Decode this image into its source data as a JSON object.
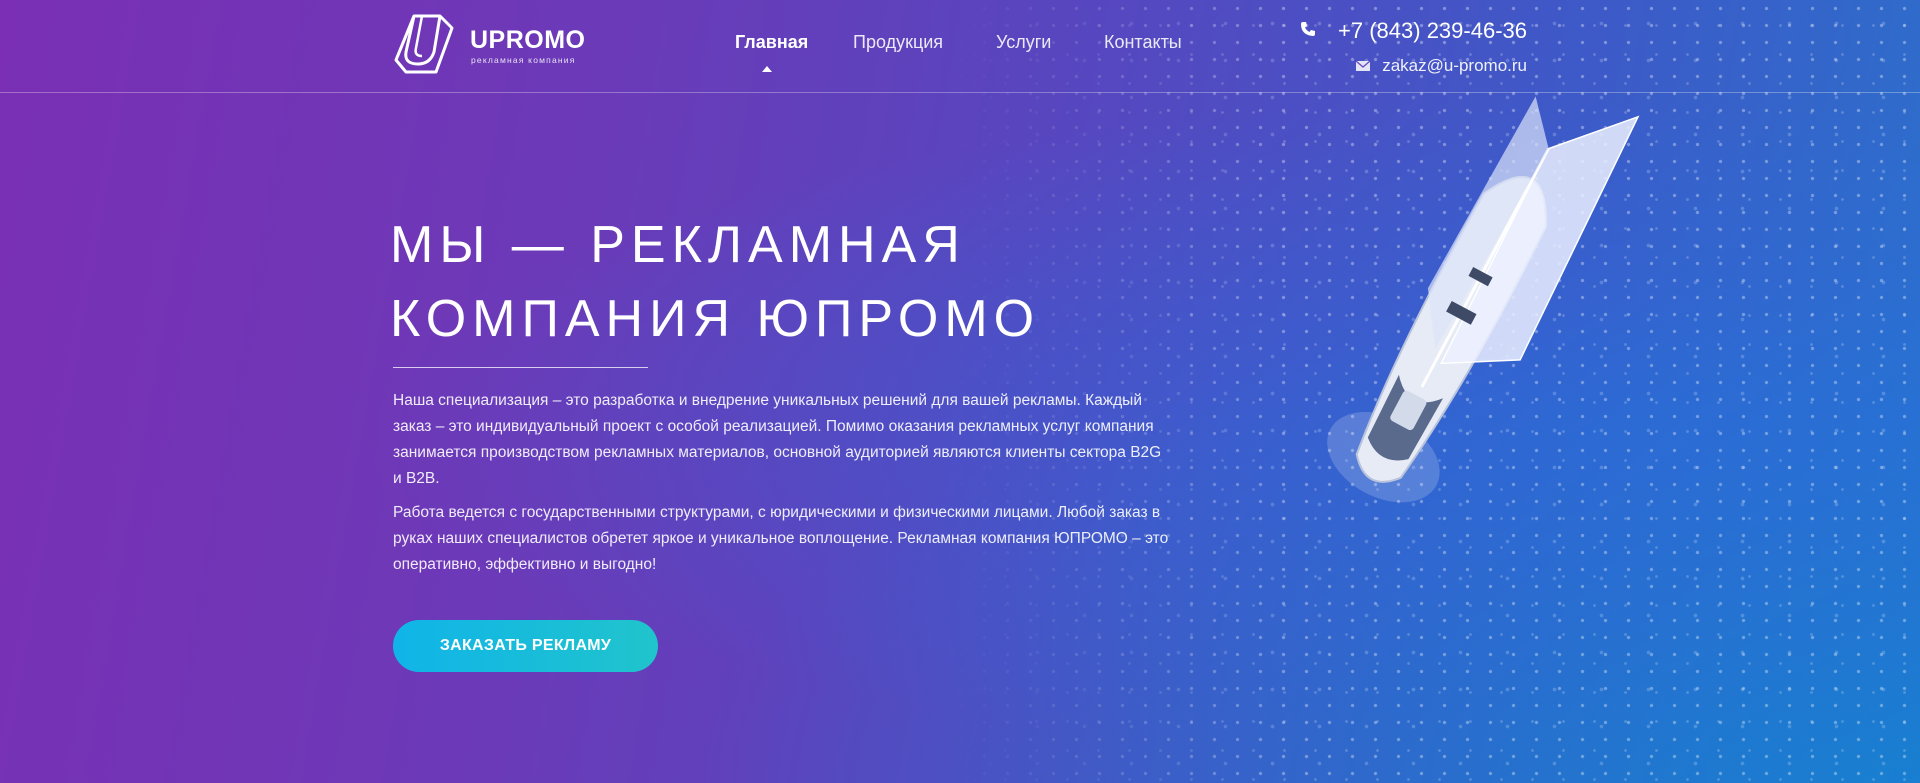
{
  "header": {
    "logo": {
      "name": "UPROMO",
      "tagline": "рекламная компания"
    },
    "nav": [
      {
        "label": "Главная",
        "active": true
      },
      {
        "label": "Продукция",
        "active": false
      },
      {
        "label": "Услуги",
        "active": false
      },
      {
        "label": "Контакты",
        "active": false
      }
    ],
    "contacts": {
      "phone": "+7 (843) 239-46-36",
      "phone_icon": "phone-icon",
      "email": "zakaz@u-promo.ru",
      "email_icon": "mail-icon"
    }
  },
  "hero": {
    "title_line1": "МЫ — РЕКЛАМНАЯ",
    "title_line2": "КОМПАНИЯ ЮПРОМО",
    "paragraph1": "Наша специализация – это разработка и внедрение уникальных решений для вашей рекламы. Каждый заказ – это индивидуальный проект с особой реализацией. Помимо оказания рекламных услуг компания занимается производством рекламных материалов, основной аудиторией являются клиенты сектора B2G и B2B.",
    "paragraph2": "Работа ведется с государственными структурами, с юридическими и физическими лицами. Любой заказ в руках наших специалистов обретет яркое и уникальное воплощение. Рекламная компания ЮПРОМО – это оперативно, эффективно и выгодно!",
    "cta_label": "ЗАКАЗАТЬ РЕКЛАМУ"
  },
  "colors": {
    "gradient_start": "#7a2fb4",
    "gradient_end": "#2a72cc",
    "cta_start": "#10b4e8",
    "cta_end": "#20c4cc"
  }
}
